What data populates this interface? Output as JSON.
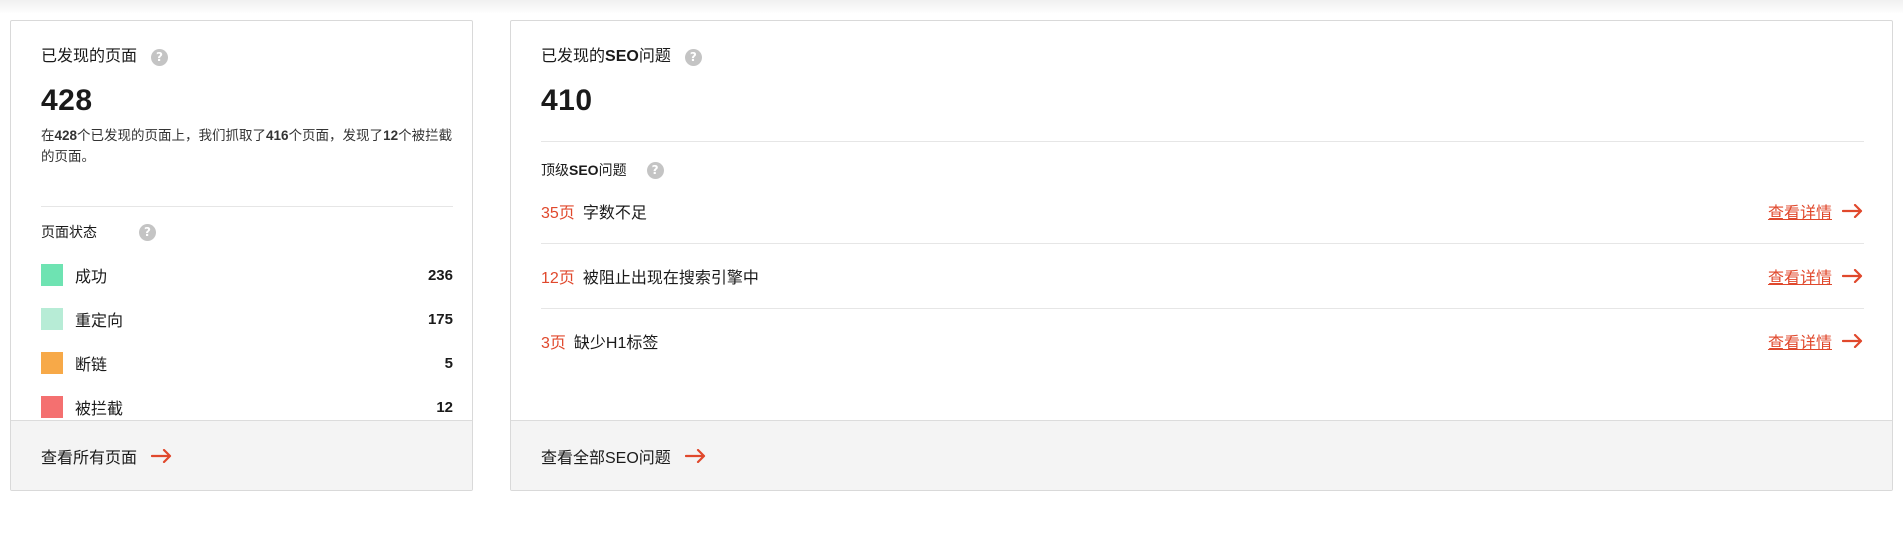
{
  "pages_card": {
    "title": "已发现的页面",
    "total": "428",
    "desc_prefix": "在",
    "desc_discovered": "428",
    "desc_mid1": "个已发现的页面上，我们抓取了",
    "desc_crawled": "416",
    "desc_mid2": "个页面，发现了",
    "desc_blocked": "12",
    "desc_suffix": "个被拦截的页面。",
    "status_heading": "页面状态",
    "statuses": [
      {
        "label": "成功",
        "count": "236",
        "color": "#6ee3b2"
      },
      {
        "label": "重定向",
        "count": "175",
        "color": "#b7ecd6"
      },
      {
        "label": "断链",
        "count": "5",
        "color": "#f7a948"
      },
      {
        "label": "被拦截",
        "count": "12",
        "color": "#f47070"
      }
    ],
    "footer_label": "查看所有页面"
  },
  "seo_card": {
    "title_prefix": "已发现的",
    "title_bold": "SEO",
    "title_suffix": "问题",
    "total": "410",
    "top_heading_prefix": "顶级",
    "top_heading_bold": "SEO",
    "top_heading_suffix": "问题",
    "issues": [
      {
        "count": "35页",
        "text": "字数不足",
        "link": "查看详情"
      },
      {
        "count": "12页",
        "text": "被阻止出现在搜索引擎中",
        "link": "查看详情"
      },
      {
        "count": "3页",
        "text": "缺少H1标签",
        "link": "查看详情"
      }
    ],
    "footer_label": "查看全部SEO问题"
  },
  "icons": {
    "help": "question-mark-icon",
    "arrow": "arrow-right-icon"
  },
  "colors": {
    "accent": "#e0482c",
    "help_icon": "#c4c4c4",
    "footer_bg": "#f4f4f4"
  },
  "help_glyph": "?"
}
